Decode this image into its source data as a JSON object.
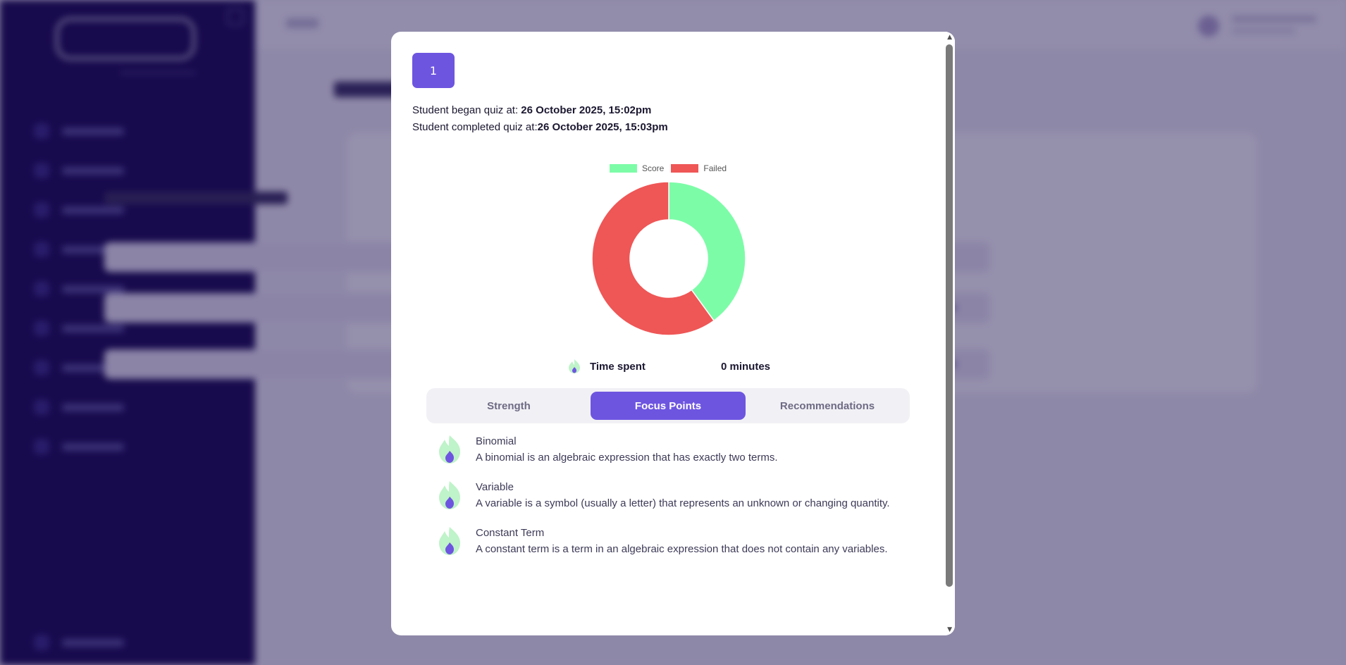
{
  "quiz": {
    "attempt_number": "1",
    "began_label": "Student began quiz at: ",
    "began_value": "26 October 2025, 15:02pm",
    "completed_label": "Student completed quiz at:",
    "completed_value": "26 October 2025, 15:03pm"
  },
  "chart_data": {
    "type": "pie",
    "variant": "doughnut",
    "categories": [
      "Score",
      "Failed"
    ],
    "values": [
      40,
      60
    ],
    "colors": [
      "#7dfca8",
      "#ef5656"
    ],
    "legend_position": "top"
  },
  "time_spent": {
    "label": "Time spent",
    "value": "0 minutes",
    "icon": "flame-icon"
  },
  "tabs": [
    {
      "label": "Strength",
      "active": false
    },
    {
      "label": "Focus Points",
      "active": true
    },
    {
      "label": "Recommendations",
      "active": false
    }
  ],
  "focus_points": [
    {
      "title": "Binomial",
      "description": "A binomial is an algebraic expression that has exactly two terms.",
      "icon": "flame-icon"
    },
    {
      "title": "Variable",
      "description": "A variable is a symbol (usually a letter) that represents an unknown or changing quantity.",
      "icon": "flame-icon"
    },
    {
      "title": "Constant Term",
      "description": "A constant term is a term in an algebraic expression that does not contain any variables.",
      "icon": "flame-icon"
    }
  ],
  "colors": {
    "accent": "#6e55e0",
    "sidebar": "#1a0b52",
    "score": "#7dfca8",
    "failed": "#ef5656"
  }
}
